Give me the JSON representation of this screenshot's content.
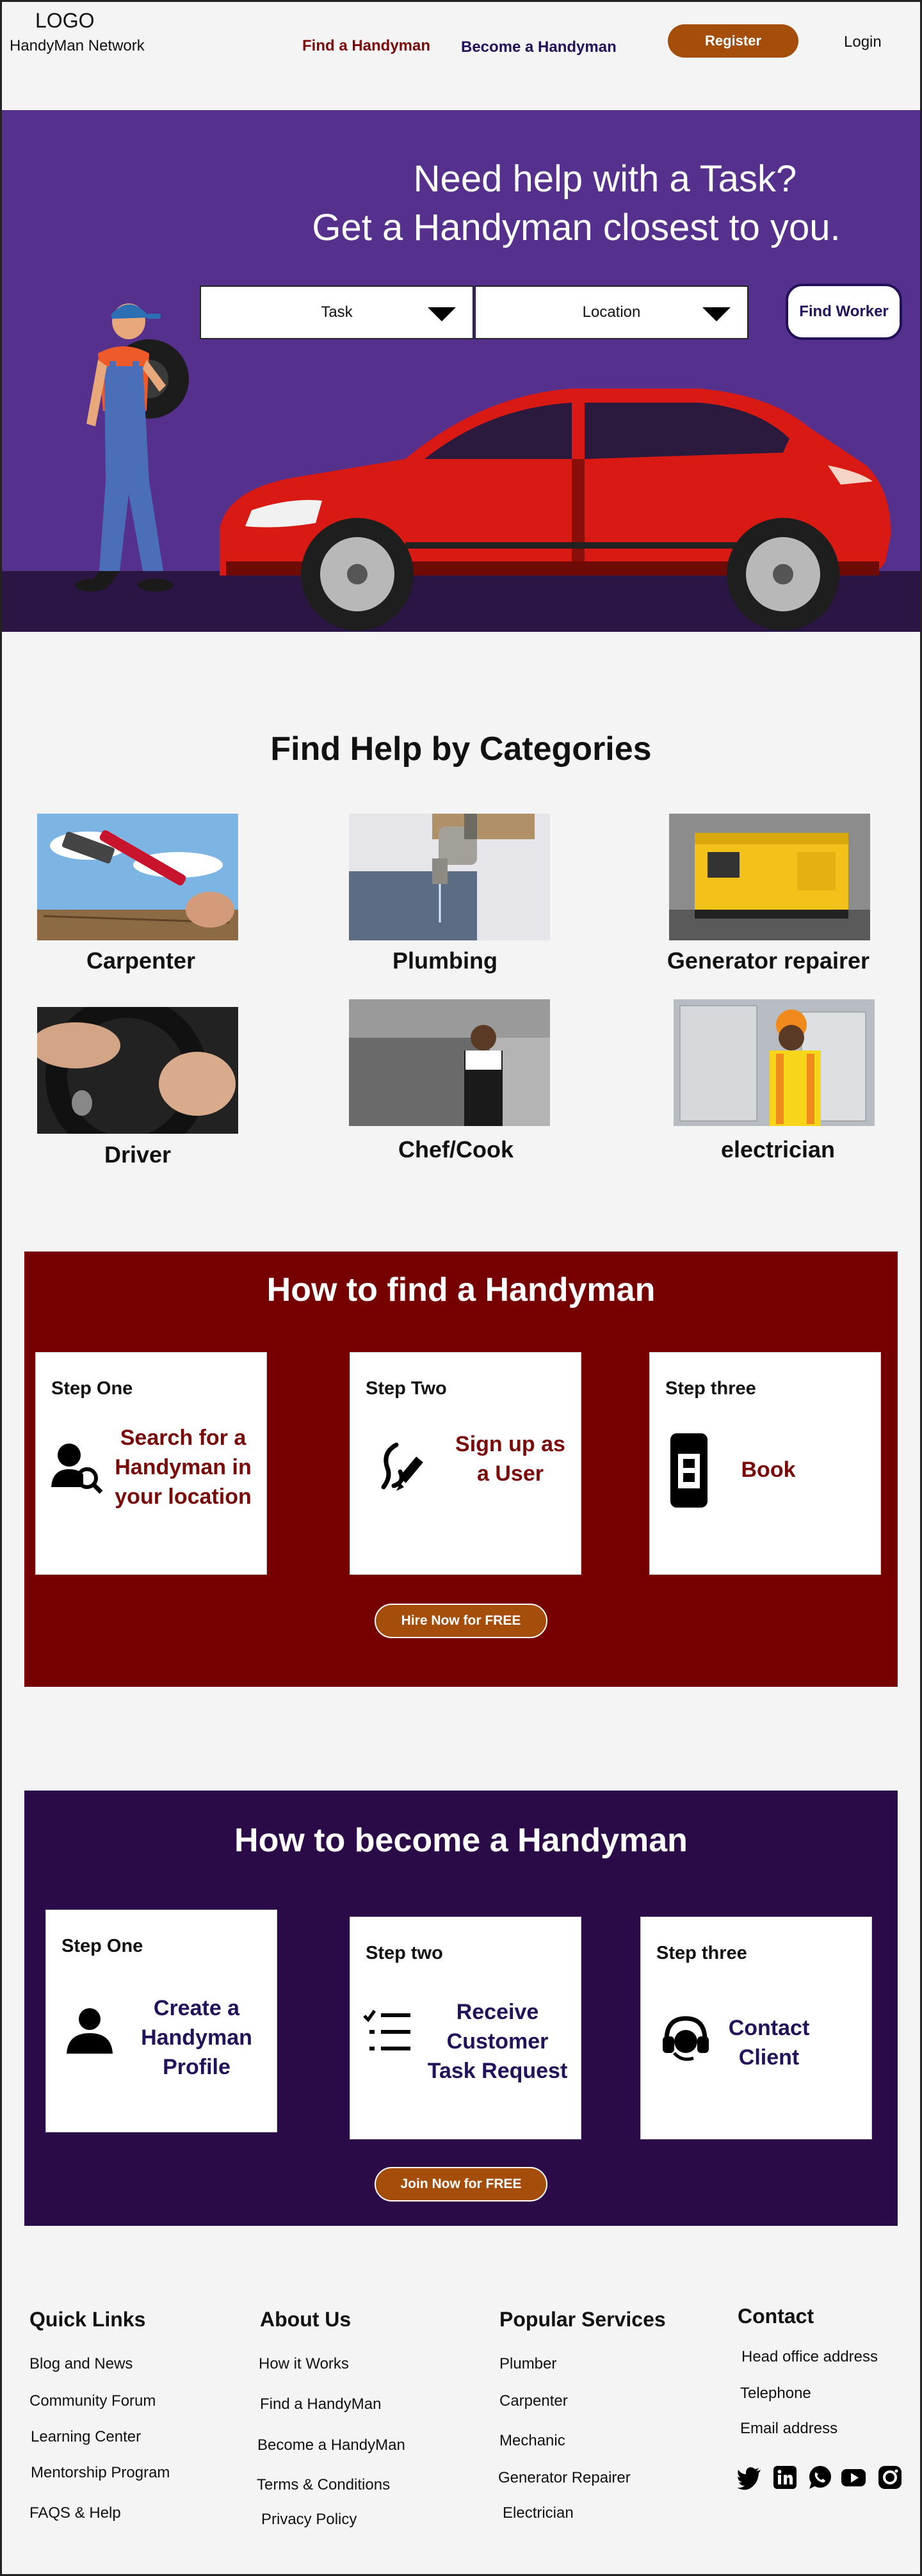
{
  "header": {
    "logo": "LOGO",
    "brand": "HandyMan Network",
    "nav_find": "Find a Handyman",
    "nav_become": "Become a Handyman",
    "register": "Register",
    "login": "Login"
  },
  "hero": {
    "line1": "Need help with a Task?",
    "line2": "Get a Handyman closest to you.",
    "task_select": "Task",
    "location_select": "Location",
    "find_button": "Find Worker"
  },
  "categories": {
    "title": "Find Help by Categories",
    "items": [
      "Carpenter",
      "Plumbing",
      "Generator repairer",
      "Driver",
      "Chef/Cook",
      "electrician"
    ]
  },
  "find_section": {
    "title": "How to find a Handyman",
    "steps": [
      {
        "label": "Step One",
        "text1": "Search for a",
        "text2": "Handyman in",
        "text3": "your location"
      },
      {
        "label": "Step Two",
        "text1": "Sign up as",
        "text2": "a User"
      },
      {
        "label": "Step three",
        "text1": "Book"
      }
    ],
    "cta": "Hire Now for FREE"
  },
  "become_section": {
    "title": "How to become a Handyman",
    "steps": [
      {
        "label": "Step One",
        "text1": "Create a",
        "text2": "Handyman",
        "text3": "Profile"
      },
      {
        "label": "Step two",
        "text1": "Receive",
        "text2": "Customer",
        "text3": "Task Request"
      },
      {
        "label": "Step three",
        "text1": "Contact",
        "text2": "Client"
      }
    ],
    "cta": "Join Now for FREE"
  },
  "footer": {
    "quick_links": {
      "title": "Quick Links",
      "items": [
        "Blog and News",
        "Community Forum",
        "Learning Center",
        "Mentorship Program",
        "FAQS & Help"
      ]
    },
    "about": {
      "title": "About Us",
      "items": [
        "How it Works",
        "Find a HandyMan",
        "Become a HandyMan",
        "Terms & Conditions",
        "Privacy Policy"
      ]
    },
    "services": {
      "title": "Popular Services",
      "items": [
        "Plumber",
        "Carpenter",
        "Mechanic",
        "Generator Repairer",
        "Electrician"
      ]
    },
    "contact": {
      "title": "Contact",
      "items": [
        "Head office address",
        "Telephone",
        "Email address"
      ]
    },
    "social_icons": [
      "twitter-icon",
      "linkedin-icon",
      "whatsapp-icon",
      "youtube-icon",
      "instagram-icon"
    ]
  },
  "colors": {
    "hero_bg": "#55308c",
    "find_bg": "#760000",
    "become_bg": "#2a0a47",
    "accent": "#a54e0c",
    "red_text": "#7a0a0a",
    "purple_text": "#23115a"
  }
}
